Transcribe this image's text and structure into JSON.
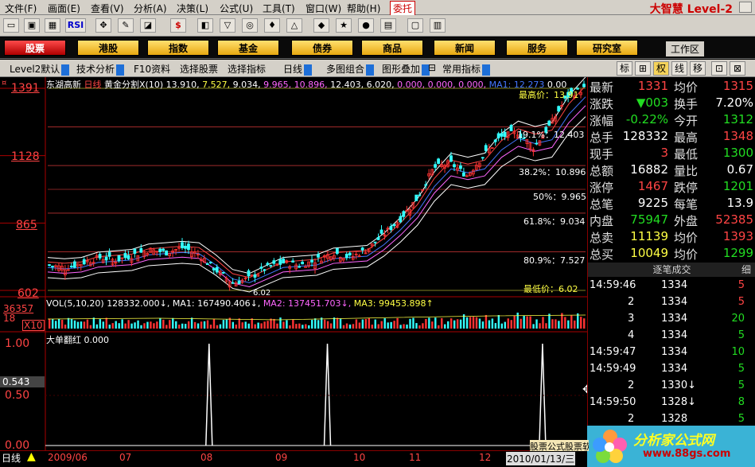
{
  "menu": {
    "items": [
      "文件(F)",
      "画面(E)",
      "查看(V)",
      "分析(A)",
      "决策(L)",
      "公式(U)",
      "工具(T)",
      "窗口(W)",
      "帮助(H)"
    ],
    "trust": "委托",
    "brand": "大智慧 Level-2"
  },
  "toolbar": {
    "rsi": "RSI"
  },
  "nav": {
    "items": [
      "股票",
      "港股",
      "指数",
      "基金",
      "债券",
      "商品",
      "新闻",
      "服务",
      "研究室"
    ],
    "workarea": "工作区"
  },
  "tabs": {
    "items": [
      "Level2默认",
      "技术分析",
      "F10资料",
      "选择股票",
      "选择指标",
      "日线",
      "多图组合",
      "图形叠加",
      "常用指标"
    ],
    "right": [
      "标",
      "⊞",
      "权",
      "线",
      "移",
      "⊡",
      "⊠"
    ]
  },
  "chart": {
    "stock": "东湖高新",
    "period": "日线",
    "indicator": "黄金分割X(10)",
    "params": [
      "13.910,",
      "7.527,",
      "9.034,",
      "9.965,",
      "10.896,",
      "12.403,",
      "6.020,",
      "0.000,",
      "0.000,",
      "0.000,",
      "MA1:",
      "12.273"
    ],
    "param_trail": "0.00",
    "price_axis": [
      "1391",
      "1128",
      "865",
      "602"
    ],
    "fib": [
      "最高价：13.91",
      "19.1%：12.403",
      "38.2%：10.896",
      "50%：9.965",
      "61.8%：9.034",
      "80.9%：7.527",
      "最低价：6.02"
    ],
    "low_label": "6.02",
    "vol": {
      "label": "VOL(5,10,20)",
      "value": "128332.000",
      "ma1": "MA1: 167490.406",
      "ma2": "MA2: 137451.703",
      "ma3": "MA3: 99453.898"
    },
    "vol_axis": [
      "36357",
      "18",
      "X10"
    ],
    "ind2": {
      "label": "大单翻红",
      "value": "0.000",
      "axis": [
        "1.00",
        "0.543",
        "0.50",
        "0.00"
      ]
    },
    "dates": [
      "2009/06",
      "07",
      "08",
      "09",
      "10",
      "11",
      "12",
      "2010/01/13/三"
    ],
    "period_btn": "日线"
  },
  "chart_data": {
    "type": "line",
    "title": "东湖高新 日线",
    "ylim": [
      6.02,
      13.91
    ],
    "fib_levels": [
      13.91,
      12.403,
      10.896,
      9.965,
      9.034,
      7.527,
      6.02
    ],
    "close": [
      7.0,
      6.9,
      7.1,
      7.3,
      7.2,
      7.4,
      7.6,
      7.5,
      7.7,
      7.4,
      6.8,
      6.3,
      6.5,
      6.9,
      7.1,
      7.0,
      7.2,
      7.5,
      7.3,
      7.6,
      8.2,
      8.8,
      9.6,
      10.8,
      11.0,
      10.5,
      11.3,
      12.0,
      12.2,
      11.6,
      12.5,
      13.6,
      13.9
    ],
    "signal_spikes": [
      0.3,
      0.52,
      0.92
    ],
    "ind2_ylim": [
      0,
      1
    ]
  },
  "quote": {
    "rows": [
      [
        "最新",
        "1331",
        "red",
        "均价",
        "1315",
        "red"
      ],
      [
        "涨跌",
        "▼003",
        "green",
        "换手",
        "7.20%",
        "white"
      ],
      [
        "涨幅",
        "-0.22%",
        "green",
        "今开",
        "1312",
        "green"
      ],
      [
        "总手",
        "128332",
        "white",
        "最高",
        "1348",
        "red"
      ],
      [
        "现手",
        "3",
        "red",
        "最低",
        "1300",
        "green"
      ],
      [
        "总额",
        "16882",
        "white",
        "量比",
        "0.67",
        "white"
      ],
      [
        "涨停",
        "1467",
        "red",
        "跌停",
        "1201",
        "green"
      ],
      [
        "总笔",
        "9225",
        "white",
        "每笔",
        "13.9",
        "white"
      ],
      [
        "内盘",
        "75947",
        "green",
        "外盘",
        "52385",
        "red"
      ],
      [
        "总卖",
        "11139",
        "yellow",
        "均价",
        "1393",
        "red"
      ],
      [
        "总买",
        "10049",
        "yellow",
        "均价",
        "1299",
        "green"
      ]
    ],
    "tick_header": "逐笔成交",
    "tick_detail": "细",
    "ticks": [
      [
        "14:59:46",
        "1334",
        "5",
        "red"
      ],
      [
        "2",
        "1334",
        "5",
        "red"
      ],
      [
        "3",
        "1334",
        "20",
        "green"
      ],
      [
        "4",
        "1334",
        "5",
        "green"
      ],
      [
        "14:59:47",
        "1334",
        "10",
        "green"
      ],
      [
        "14:59:49",
        "1334",
        "5",
        "green"
      ],
      [
        "2",
        "1330↓",
        "5",
        "green"
      ],
      [
        "14:59:50",
        "1328↓",
        "8",
        "green"
      ],
      [
        "2",
        "1328",
        "5",
        "green"
      ]
    ]
  },
  "watermark": {
    "title": "分析家公式网",
    "url": "www.88gs.com",
    "caption": "股票公式股票软件"
  }
}
